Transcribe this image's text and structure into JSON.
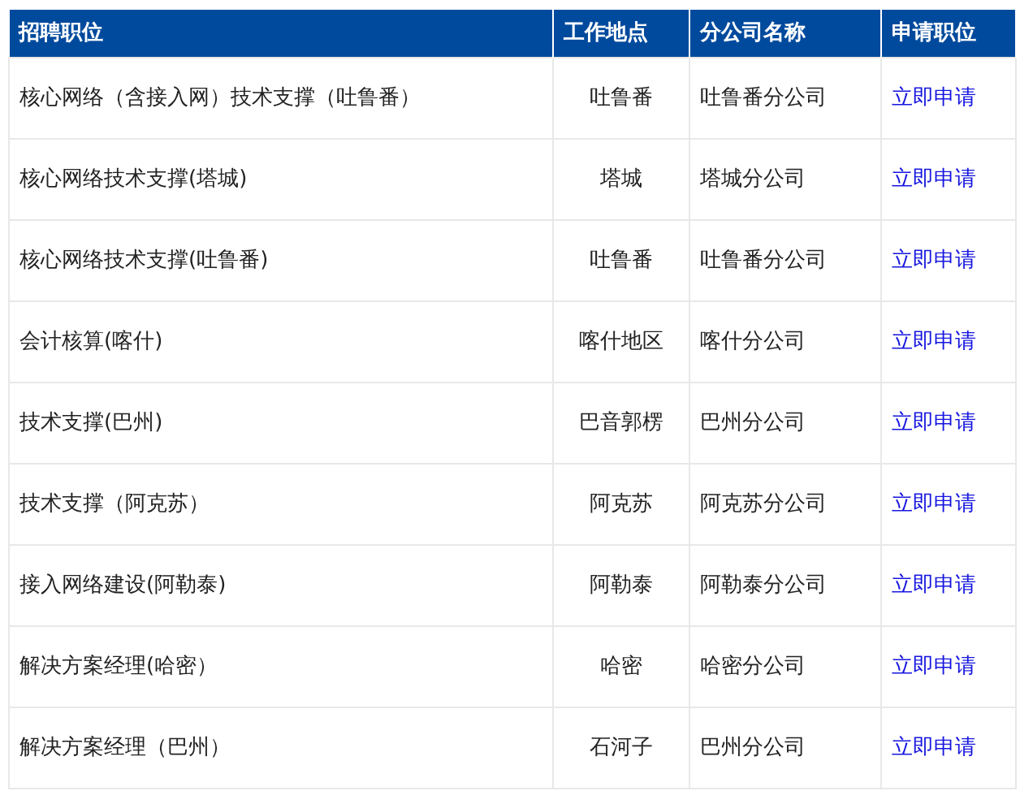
{
  "table": {
    "columns": [
      "招聘职位",
      "工作地点",
      "分公司名称",
      "申请职位"
    ],
    "rows": [
      {
        "position": "核心网络（含接入网）技术支撑（吐鲁番）",
        "location": "吐鲁番",
        "branch": "吐鲁番分公司",
        "apply": "立即申请"
      },
      {
        "position": "核心网络技术支撑(塔城)",
        "location": "塔城",
        "branch": "塔城分公司",
        "apply": "立即申请"
      },
      {
        "position": "核心网络技术支撑(吐鲁番)",
        "location": "吐鲁番",
        "branch": "吐鲁番分公司",
        "apply": "立即申请"
      },
      {
        "position": "会计核算(喀什)",
        "location": "喀什地区",
        "branch": "喀什分公司",
        "apply": "立即申请"
      },
      {
        "position": "技术支撑(巴州)",
        "location": "巴音郭楞",
        "branch": "巴州分公司",
        "apply": "立即申请"
      },
      {
        "position": "技术支撑（阿克苏）",
        "location": "阿克苏",
        "branch": "阿克苏分公司",
        "apply": "立即申请"
      },
      {
        "position": "接入网络建设(阿勒泰)",
        "location": "阿勒泰",
        "branch": "阿勒泰分公司",
        "apply": "立即申请"
      },
      {
        "position": "解决方案经理(哈密）",
        "location": "哈密",
        "branch": "哈密分公司",
        "apply": "立即申请"
      },
      {
        "position": "解决方案经理（巴州）",
        "location": "石河子",
        "branch": "巴州分公司",
        "apply": "立即申请"
      }
    ]
  }
}
